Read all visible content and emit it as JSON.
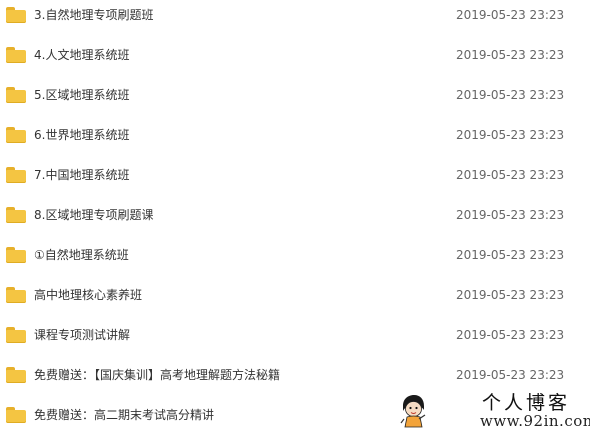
{
  "files": [
    {
      "name": "3.自然地理专项刷题班",
      "modified": "2019-05-23 23:23",
      "icon": "folder-icon"
    },
    {
      "name": "4.人文地理系统班",
      "modified": "2019-05-23 23:23",
      "icon": "folder-icon"
    },
    {
      "name": "5.区域地理系统班",
      "modified": "2019-05-23 23:23",
      "icon": "folder-icon"
    },
    {
      "name": "6.世界地理系统班",
      "modified": "2019-05-23 23:23",
      "icon": "folder-icon"
    },
    {
      "name": "7.中国地理系统班",
      "modified": "2019-05-23 23:23",
      "icon": "folder-icon"
    },
    {
      "name": "8.区域地理专项刷题课",
      "modified": "2019-05-23 23:23",
      "icon": "folder-icon"
    },
    {
      "name": "①自然地理系统班",
      "modified": "2019-05-23 23:23",
      "icon": "folder-icon"
    },
    {
      "name": "高中地理核心素养班",
      "modified": "2019-05-23 23:23",
      "icon": "folder-icon"
    },
    {
      "name": "课程专项测试讲解",
      "modified": "2019-05-23 23:23",
      "icon": "folder-icon"
    },
    {
      "name": "免费赠送：【国庆集训】高考地理解题方法秘籍",
      "modified": "2019-05-23 23:23",
      "icon": "folder-icon"
    },
    {
      "name": "免费赠送：高二期末考试高分精讲",
      "modified": "",
      "icon": "folder-icon"
    }
  ],
  "watermark": {
    "title": "个人博客",
    "url": "www.92in.com"
  },
  "colors": {
    "folder": "#f4c542",
    "folder_tab": "#e7b02a",
    "text": "#333333",
    "date_text": "#666666"
  }
}
